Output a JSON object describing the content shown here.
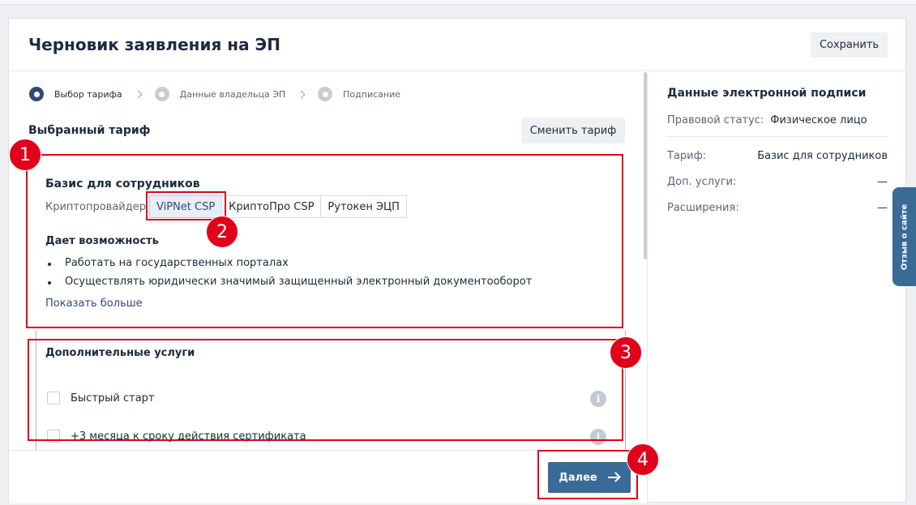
{
  "header": {
    "title": "Черновик заявления на ЭП",
    "save_label": "Сохранить"
  },
  "steps": [
    {
      "label": "Выбор тарифа",
      "active": true
    },
    {
      "label": "Данные владельца ЭП",
      "active": false
    },
    {
      "label": "Подписание",
      "active": false
    }
  ],
  "tariff": {
    "section_title": "Выбранный тариф",
    "change_label": "Сменить тариф",
    "name": "Базис для сотрудников",
    "crypto_label": "Криптопровайдер",
    "crypto_options": [
      "ViPNet CSP",
      "КриптоПро CSP",
      "Рутокен ЭЦП"
    ],
    "crypto_selected": "ViPNet CSP",
    "gives_title": "Дает возможность",
    "gives_items": [
      "Работать на государственных порталах",
      "Осуществлять юридически значимый защищенный электронный документооборот"
    ],
    "show_more": "Показать больше"
  },
  "additional": {
    "title": "Дополнительные услуги",
    "options": [
      {
        "label": "Быстрый старт",
        "checked": false
      },
      {
        "label": "+3 месяца к сроку действия сертификата",
        "checked": false
      }
    ],
    "info_glyph": "i"
  },
  "footer": {
    "next_label": "Далее"
  },
  "summary": {
    "title": "Данные электронной подписи",
    "legal_status_label": "Правовой статус:",
    "legal_status_value": "Физическое лицо",
    "rows": [
      {
        "label": "Тариф:",
        "value": "Базис для сотрудников"
      },
      {
        "label": "Доп. услуги:",
        "value": "—"
      },
      {
        "label": "Расширения:",
        "value": "—"
      }
    ]
  },
  "feedback_label": "Отзыв о сайте",
  "annotations": [
    "1",
    "2",
    "3",
    "4"
  ],
  "colors": {
    "accent": "#3a6a96",
    "primary_dark": "#2e4a7a",
    "annotation_red": "#e0001b"
  }
}
